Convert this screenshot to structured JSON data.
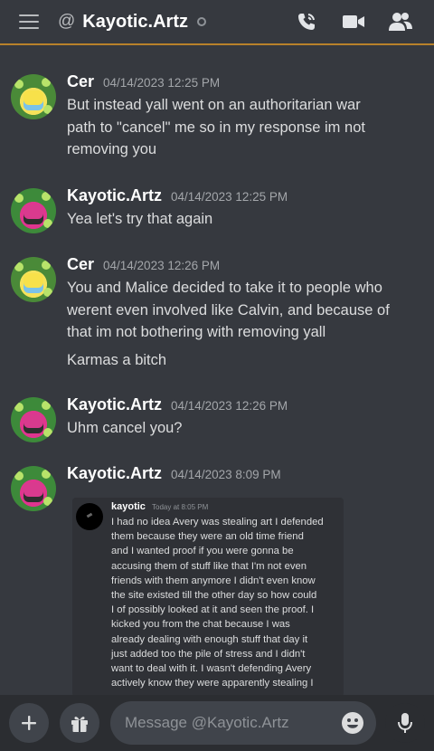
{
  "header": {
    "channel_name": "Kayotic.Artz",
    "at_symbol": "@",
    "icons": [
      "menu-icon",
      "at-icon",
      "status-offline-icon",
      "call-icon",
      "video-icon",
      "members-icon"
    ]
  },
  "messages": [
    {
      "username": "Cer",
      "timestamp": "04/14/2023 12:25 PM",
      "lines": [
        "But instead yall went on an authoritarian war",
        "path to \"cancel\" me so in my response im not",
        "removing you"
      ]
    },
    {
      "username": "Kayotic.Artz",
      "timestamp": "04/14/2023 12:25 PM",
      "lines": [
        "Yea let's try that again"
      ]
    },
    {
      "username": "Cer",
      "timestamp": "04/14/2023 12:26 PM",
      "lines": [
        "You and Malice decided to take it to people who",
        "werent even involved like Calvin, and because of",
        "that im not bothering with removing yall"
      ],
      "extra": "Karmas a bitch"
    },
    {
      "username": "Kayotic.Artz",
      "timestamp": "04/14/2023 12:26 PM",
      "lines": [
        "Uhm cancel you?"
      ]
    },
    {
      "username": "Kayotic.Artz",
      "timestamp": "04/14/2023 8:09 PM",
      "lines": []
    }
  ],
  "embed": {
    "username": "kayotic",
    "timestamp": "Today at 8:05 PM",
    "lines": [
      "I had no idea Avery was stealing art I defended",
      "them because they were an old time friend",
      "and I wanted proof if you were gonna be",
      "accusing them of stuff like that I'm not even",
      "friends with them anymore I didn't even know",
      "the site existed till the other day so how could",
      "I of possibly looked at it and seen the proof. I",
      "kicked you from the chat because I was",
      "already dealing with enough stuff that day it",
      "just added too the pile of stress and I didn't",
      "want to deal with it. I wasn't defending Avery",
      "actively know they were apparently stealing I"
    ]
  },
  "composer": {
    "placeholder": "Message @Kayotic.Artz",
    "icons": [
      "plus-icon",
      "gift-icon",
      "emoji-icon",
      "microphone-icon"
    ]
  },
  "colors": {
    "background": "#36393f",
    "accent_border": "#b8812a",
    "username": "#ffffff",
    "timestamp": "#a3a6aa",
    "text": "#dcddde"
  }
}
